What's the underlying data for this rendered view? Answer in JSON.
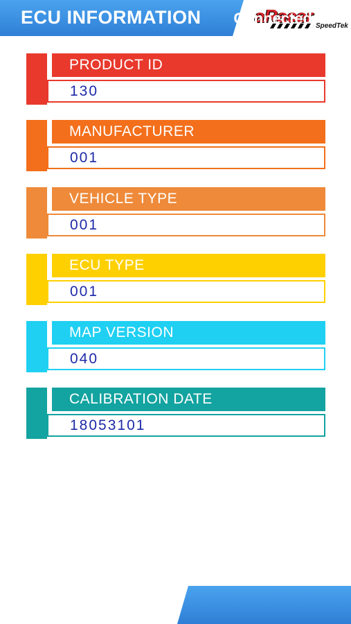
{
  "header": {
    "title": "ECU INFORMATION"
  },
  "logo": {
    "main": "aRacer",
    "sub": "SpeedTek"
  },
  "fields": [
    {
      "label": "PRODUCT ID",
      "value": "130",
      "color": "#e8392c"
    },
    {
      "label": "MANUFACTURER",
      "value": "001",
      "color": "#f36f1b"
    },
    {
      "label": "VEHICLE TYPE",
      "value": "001",
      "color": "#ee8a3a"
    },
    {
      "label": "ECU TYPE",
      "value": "001",
      "color": "#ffd000"
    },
    {
      "label": "MAP VERSION",
      "value": "040",
      "color": "#1fd0f2"
    },
    {
      "label": "CALIBRATION DATE",
      "value": "18053101",
      "color": "#13a3a0"
    }
  ],
  "status": {
    "text": "Connected"
  }
}
